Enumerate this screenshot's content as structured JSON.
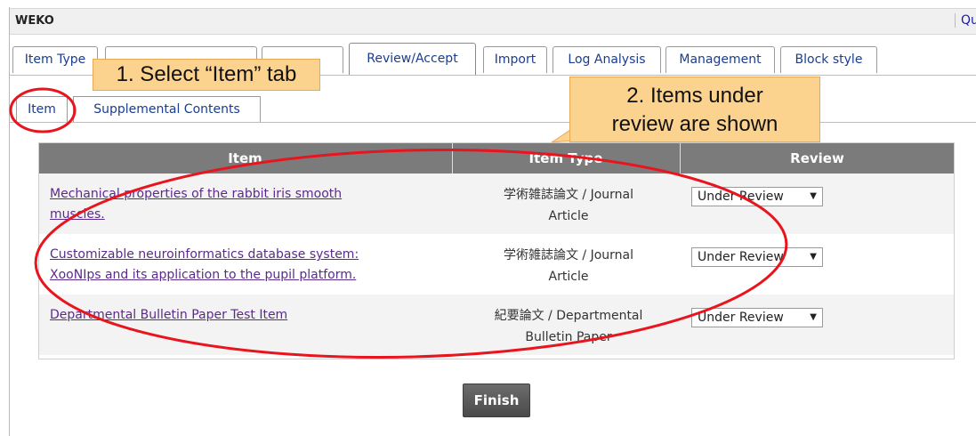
{
  "app": {
    "title": "WEKO",
    "quit_label": "Quit"
  },
  "tabs": [
    {
      "label": "Item Type"
    },
    {
      "label": ""
    },
    {
      "label": ""
    },
    {
      "label": "Review/Accept"
    },
    {
      "label": "Import"
    },
    {
      "label": "Log Analysis"
    },
    {
      "label": "Management"
    },
    {
      "label": "Block style"
    }
  ],
  "subtabs": [
    {
      "label": "Item"
    },
    {
      "label": "Supplemental Contents"
    }
  ],
  "table": {
    "headers": [
      "Item",
      "Item Type",
      "Review"
    ],
    "rows": [
      {
        "title_line1": "Mechanical properties of the rabbit iris smooth",
        "title_line2": "muscles.",
        "type_line1": "学術雑誌論文 / Journal",
        "type_line2": "Article",
        "review": "Under Review"
      },
      {
        "title_line1": "Customizable neuroinformatics database system:",
        "title_line2": "XooNIps and its application to the pupil platform.",
        "type_line1": "学術雑誌論文 / Journal",
        "type_line2": "Article",
        "review": "Under Review"
      },
      {
        "title_line1": "Departmental Bulletin Paper Test Item",
        "title_line2": "",
        "type_line1": "紀要論文 / Departmental",
        "type_line2": "Bulletin Paper",
        "review": "Under Review"
      }
    ]
  },
  "finish_label": "Finish",
  "annotations": {
    "callout1": "1. Select “Item” tab",
    "callout2_line1": "2. Items under",
    "callout2_line2": "review are shown",
    "highlight_color": "#e8141e",
    "callout_color": "#fbd28e"
  }
}
